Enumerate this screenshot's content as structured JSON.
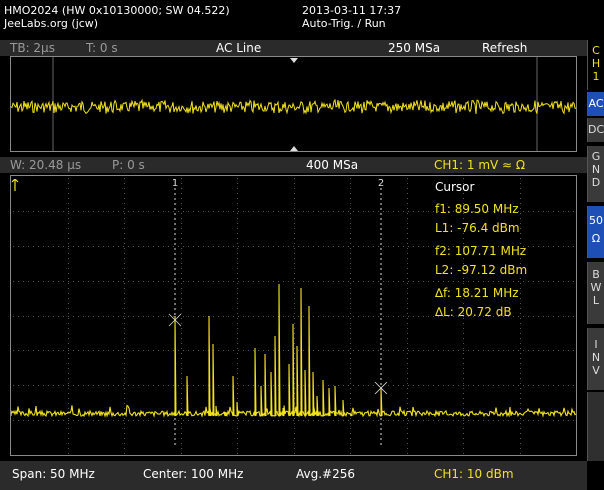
{
  "header": {
    "line1": "HMO2024 (HW 0x10130000; SW 04.522)",
    "line2": "JeeLabs.org (jcw)",
    "datetime": "2013-03-11 17:37",
    "trigger_status": "Auto-Trig. / Run"
  },
  "top_bar": {
    "timebase": "TB: 2µs",
    "time_offset": "T: 0 s",
    "trigger_source": "AC Line",
    "sample_rate": "250 MSa",
    "mode": "Refresh"
  },
  "zoom_bar": {
    "window": "W: 20.48 µs",
    "position": "P: 0 s",
    "sample_rate": "400 MSa",
    "channel_scale": "CH1: 1 mV ≈ Ω"
  },
  "cursor": {
    "title": "Cursor",
    "f1": "f1: 89.50 MHz",
    "l1": "L1: -76.4 dBm",
    "f2": "f2: 107.71 MHz",
    "l2": "L2: -97.12 dBm",
    "df": "∆f: 18.21 MHz",
    "dl": "∆L: 20.72 dB",
    "marker1": "1",
    "marker2": "2"
  },
  "bottom_bar": {
    "span": "Span: 50 MHz",
    "center": "Center: 100 MHz",
    "avg": "Avg.#256",
    "channel_level": "CH1: 10 dBm"
  },
  "side_panel": {
    "ch": [
      "C",
      "H",
      "1"
    ],
    "ac": "AC",
    "dc": "DC",
    "gnd": [
      "G",
      "N",
      "D"
    ],
    "ohm": [
      "50",
      "Ω"
    ],
    "bwl": [
      "B",
      "W",
      "L"
    ],
    "inv": [
      "I",
      "N",
      "V"
    ]
  },
  "colors": {
    "trace": "#f2e21d",
    "active_button": "#1e4fb6"
  }
}
